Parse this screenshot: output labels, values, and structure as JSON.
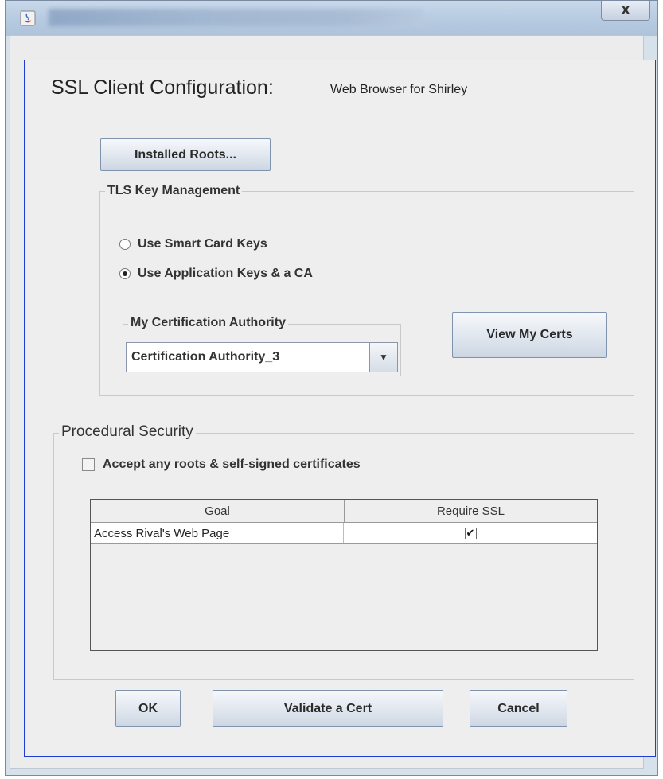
{
  "window": {
    "close_label": "X"
  },
  "dialog": {
    "heading": "SSL Client Configuration:",
    "subheading": "Web Browser for Shirley"
  },
  "installed_roots_button": "Installed Roots...",
  "tls": {
    "legend": "TLS Key Management",
    "options": [
      {
        "label": "Use Smart Card Keys",
        "selected": false
      },
      {
        "label": "Use Application Keys & a CA",
        "selected": true
      }
    ],
    "ca_group_legend": "My Certification Authority",
    "ca_selected": "Certification Authority_3",
    "view_certs_button": "View My Certs"
  },
  "procedural": {
    "legend": "Procedural Security",
    "accept_checkbox_label": "Accept any roots & self-signed certificates",
    "accept_checked": false,
    "table": {
      "columns": [
        "Goal",
        "Require SSL"
      ],
      "rows": [
        {
          "goal": "Access Rival's Web Page",
          "require_ssl_mark": "✔",
          "require_ssl": true
        }
      ]
    }
  },
  "footer": {
    "ok": "OK",
    "validate": "Validate a Cert",
    "cancel": "Cancel"
  },
  "colors": {
    "accent_border": "#1e3cd8",
    "titlebar": "#b7cbe1"
  }
}
